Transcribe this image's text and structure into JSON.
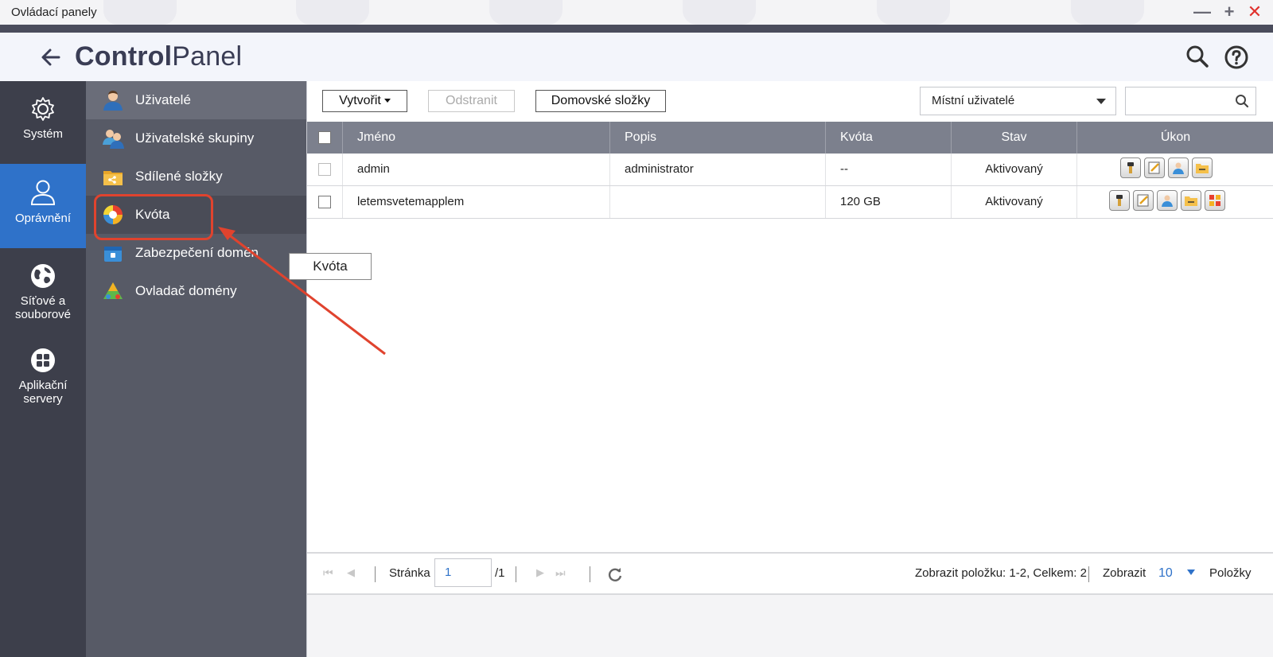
{
  "window": {
    "title": "Ovládací panely"
  },
  "header": {
    "title_bold": "Control",
    "title_light": "Panel"
  },
  "rail": {
    "items": [
      {
        "label": "Systém",
        "icon": "gear-icon"
      },
      {
        "label": "Oprávnění",
        "icon": "user-icon",
        "active": true
      },
      {
        "label_line1": "Síťové a",
        "label_line2": "souborové",
        "icon": "globe-icon"
      },
      {
        "label_line1": "Aplikační",
        "label_line2": "servery",
        "icon": "apps-grid-icon"
      }
    ]
  },
  "submenu": {
    "items": [
      {
        "label": "Uživatelé",
        "icon": "user-icon"
      },
      {
        "label": "Uživatelské skupiny",
        "icon": "user-group-icon"
      },
      {
        "label": "Sdílené složky",
        "icon": "shared-folder-icon"
      },
      {
        "label": "Kvóta",
        "icon": "quota-pie-icon",
        "selected": true
      },
      {
        "label": "Zabezpečení domén",
        "icon": "domain-security-icon"
      },
      {
        "label": "Ovladač domény",
        "icon": "domain-controller-icon"
      }
    ]
  },
  "toolbar": {
    "create_label": "Vytvořit",
    "delete_label": "Odstranit",
    "home_folders_label": "Domovské složky",
    "user_type_selected": "Místní uživatelé",
    "search_placeholder": ""
  },
  "table": {
    "columns": [
      "Jméno",
      "Popis",
      "Kvóta",
      "Stav",
      "Úkon"
    ],
    "rows": [
      {
        "name": "admin",
        "description": "administrator",
        "quota": "--",
        "status": "Aktivovaný"
      },
      {
        "name": "letemsvetemapplem",
        "description": "",
        "quota": "120 GB",
        "status": "Aktivovaný"
      }
    ]
  },
  "tooltip": {
    "text": "Kvóta"
  },
  "pager": {
    "page_label": "Stránka",
    "page_value": "1",
    "page_total": "/1",
    "summary": "Zobrazit položku: 1-2, Celkem: 2",
    "show_label": "Zobrazit",
    "per_page": "10",
    "items_label": "Položky"
  },
  "colors": {
    "accent": "#2f72c9",
    "highlight": "#e0432e",
    "rail": "#3d3f4b",
    "submenu": "#575a66"
  }
}
